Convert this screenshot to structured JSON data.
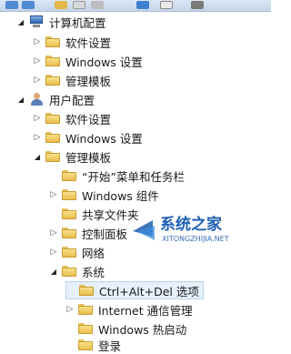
{
  "colors": {
    "toolbar": "#c6d5ea",
    "selection": "#e6f0fa",
    "folder": "#e9bf4f",
    "watermark_blue": "#1d5fb3"
  },
  "tree": {
    "computer_config": "计算机配置",
    "computer_children": [
      "软件设置",
      "Windows 设置",
      "管理模板"
    ],
    "user_config": "用户配置",
    "user_children": [
      "软件设置",
      "Windows 设置"
    ],
    "user_admin_templates": "管理模板",
    "admin_children": [
      "“开始”菜单和任务栏",
      "Windows 组件",
      "共享文件夹",
      "控制面板",
      "网络"
    ],
    "system": "系统",
    "system_children": [
      "Ctrl+Alt+Del 选项",
      "Internet 通信管理",
      "Windows 热启动",
      "登录"
    ]
  },
  "watermark": {
    "brand": "系统之家",
    "url": "XITONGZHIJIA.NET"
  }
}
